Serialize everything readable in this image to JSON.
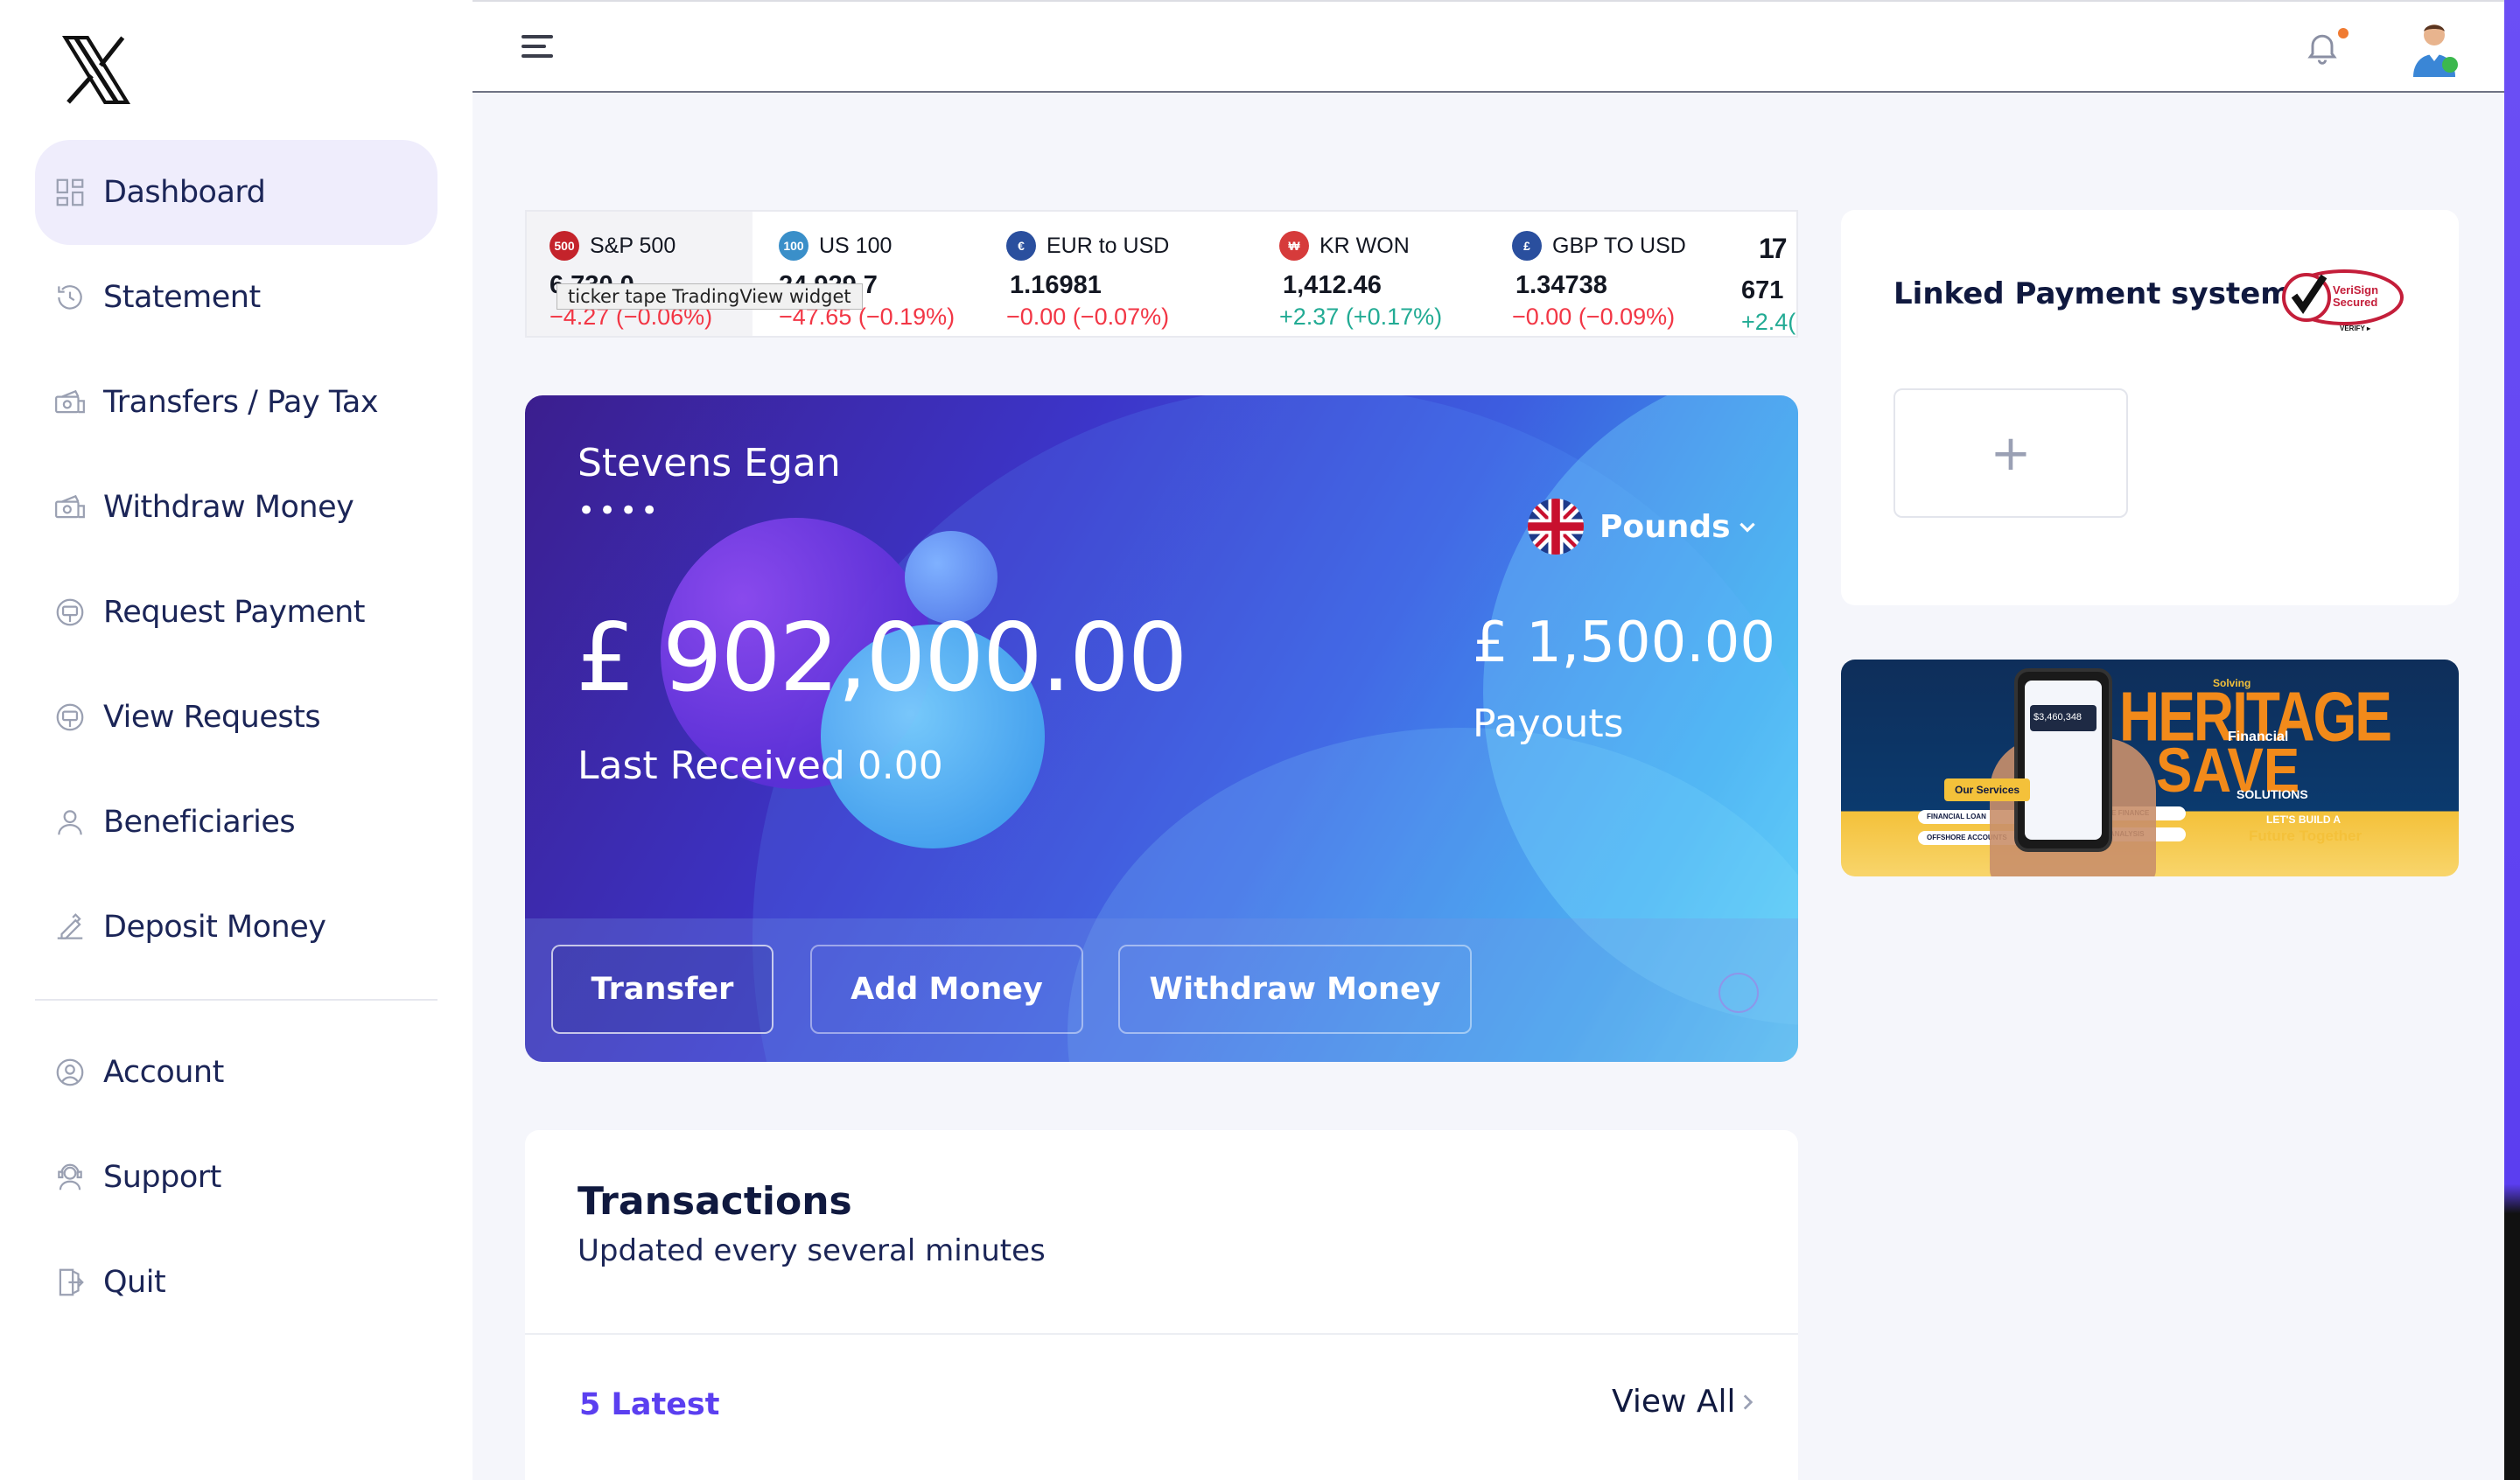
{
  "app": {
    "logo_icon": "x-logo-icon"
  },
  "sidebar": {
    "items": [
      {
        "label": "Dashboard",
        "icon": "dashboard-icon",
        "active": true
      },
      {
        "label": "Statement",
        "icon": "history-icon"
      },
      {
        "label": "Transfers / Pay Tax",
        "icon": "cash-transfer-icon"
      },
      {
        "label": "Withdraw Money",
        "icon": "cash-withdraw-icon"
      },
      {
        "label": "Request Payment",
        "icon": "money-request-icon"
      },
      {
        "label": "View Requests",
        "icon": "money-view-icon"
      },
      {
        "label": "Beneficiaries",
        "icon": "user-icon"
      },
      {
        "label": "Deposit Money",
        "icon": "deposit-icon"
      }
    ],
    "secondary_items": [
      {
        "label": "Account",
        "icon": "account-circle-icon"
      },
      {
        "label": "Support",
        "icon": "support-agent-icon"
      },
      {
        "label": "Quit",
        "icon": "logout-icon"
      }
    ]
  },
  "topbar": {
    "menu_icon": "hamburger-menu-icon",
    "bell_icon": "bell-icon",
    "avatar": "user-avatar"
  },
  "ticker": {
    "tooltip": "ticker tape TradingView widget",
    "items": [
      {
        "badge": "500",
        "badge_color": "#c4232b",
        "name": "S&P 500",
        "value": "6,730.0",
        "change": "",
        "direction": "neg"
      },
      {
        "badge": "100",
        "badge_color": "#3a8fc9",
        "name": "US 100",
        "value": "24,929.7",
        "change": "−0.19%)",
        "direction": "neg"
      },
      {
        "badge": "",
        "badge_color": "#2a4f9e",
        "name": "EUR to USD",
        "value": "1.16981",
        "change": "−0.00 (−0.07%)",
        "direction": "neg"
      },
      {
        "badge": "",
        "badge_color": "#d63b3b",
        "name": "KR WON",
        "value": "1,412.46",
        "change": "+2.37 (+0.17%)",
        "direction": "pos"
      },
      {
        "badge": "",
        "badge_color": "#2a4f9e",
        "name": "GBP TO USD",
        "value": "1.34738",
        "change": "−0.00 (−0.09%)",
        "direction": "neg"
      },
      {
        "badge": "",
        "badge_color": "#131722",
        "name": "",
        "value": "671",
        "change": "+2.4(",
        "direction": "pos"
      }
    ]
  },
  "card": {
    "holder": "Stevens Egan",
    "masked": "••••",
    "balance": "£ 902,000.00",
    "last_received": "Last Received 0.00",
    "currency": "Pounds",
    "payout_amount": "£ 1,500.00",
    "payout_label": "Payouts",
    "buttons": {
      "transfer": "Transfer",
      "add_money": "Add Money",
      "withdraw": "Withdraw Money"
    }
  },
  "transactions": {
    "title": "Transactions",
    "subtitle": "Updated every several minutes",
    "latest_label": "5 Latest",
    "view_all": "View All"
  },
  "linked_payment": {
    "title": "Linked Payment system",
    "add_label": "+",
    "badge": "VeriSign Secured"
  },
  "banner": {
    "solving": "Solving",
    "heritage": "HERITAGE",
    "financial": "Financial",
    "save": "SAVE",
    "solutions": "SOLUTIONS",
    "lets_build": "LET'S BUILD A",
    "future": "Future Together",
    "services": "Our Services",
    "phone_amount": "$3,460,348",
    "pills": [
      "FINANCIAL LOAN",
      "CORPORATE FINANCE",
      "OFFSHORE ACCOUNTS",
      "BUSINESS ANALYSIS"
    ]
  },
  "colors": {
    "accent": "#5b3ff0",
    "navy": "#10193f",
    "active_bg": "#efedfc"
  }
}
